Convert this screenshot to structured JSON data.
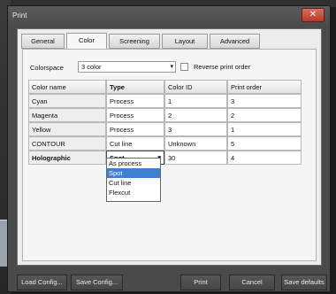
{
  "window": {
    "title": "Print",
    "close_label": "✕"
  },
  "tabs": [
    {
      "label": "General"
    },
    {
      "label": "Color"
    },
    {
      "label": "Screening"
    },
    {
      "label": "Layout"
    },
    {
      "label": "Advanced"
    }
  ],
  "active_tab": "Color",
  "colorspace": {
    "label": "Colorspace",
    "value": "3 color",
    "arrow": "▾"
  },
  "reverse_print_order": {
    "label": "Reverse print order",
    "checked": false
  },
  "table": {
    "headers": {
      "color_name": "Color name",
      "type": "Type",
      "color_id": "Color ID",
      "print_order": "Print order"
    },
    "rows": [
      {
        "color_name": "Cyan",
        "type": "Process",
        "color_id": "1",
        "print_order": "3"
      },
      {
        "color_name": "Magenta",
        "type": "Process",
        "color_id": "2",
        "print_order": "2"
      },
      {
        "color_name": "Yellow",
        "type": "Process",
        "color_id": "3",
        "print_order": "1"
      },
      {
        "color_name": "CONTOUR",
        "type": "Cut line",
        "color_id": "Unknown",
        "print_order": "5"
      },
      {
        "color_name": "Holographic",
        "type": "Spot",
        "color_id": "30",
        "print_order": "4"
      }
    ],
    "type_dropdown_arrow": "▾"
  },
  "type_options": [
    "As process",
    "Spot",
    "Cut line",
    "Flexcut"
  ],
  "type_selected": "Spot",
  "buttons": {
    "load_config": "Load Config...",
    "save_config": "Save Config...",
    "print": "Print",
    "cancel": "Cancel",
    "save_defaults": "Save defaults"
  },
  "colors": {
    "selection": "#3f7fd0",
    "dialog_bg": "#4a4a4a",
    "close_red": "#c0453a"
  }
}
